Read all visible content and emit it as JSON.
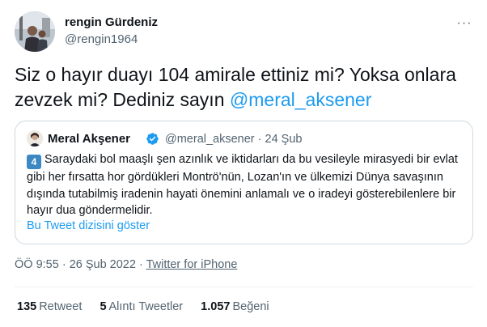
{
  "author": {
    "name": "rengin Gürdeniz",
    "handle": "@rengin1964",
    "avatar_icon": "profile-photo"
  },
  "more_icon": "more-horizontal-icon",
  "more_label": "···",
  "tweet": {
    "text": "Siz o hayır duayı 104 amirale ettiniz mi? Yoksa onlara zevzek  mi? Dediniz sayın ",
    "mention": "@meral_aksener"
  },
  "quote": {
    "name": "Meral Akşener",
    "verified_icon": "verified-badge-icon",
    "meta": "@meral_aksener · 24 Şub",
    "keycap": "4",
    "text": "Saraydaki bol maaşlı şen azınlık ve iktidarları da bu vesileyle mirasyedi bir evlat gibi her fırsatta hor gördükleri Montrö'nün, Lozan'ın ve ülkemizi Dünya savaşının dışında tutabilmiş iradenin hayati önemini anlamalı ve o iradeyi gösterebilenlere bir hayır dua göndermelidir.",
    "thread_link": "Bu Tweet dizisini göster"
  },
  "timestamp": {
    "time": "ÖÖ 9:55 · 26 Şub 2022 · ",
    "source": "Twitter for iPhone"
  },
  "stats": [
    {
      "count": "135",
      "label": "Retweet"
    },
    {
      "count": "5",
      "label": "Alıntı Tweetler"
    },
    {
      "count": "1.057",
      "label": "Beğeni"
    }
  ],
  "colors": {
    "link": "#1d9bf0",
    "secondary_text": "#536471",
    "border": "#cfd9de",
    "keycap": "#3b88c3"
  }
}
